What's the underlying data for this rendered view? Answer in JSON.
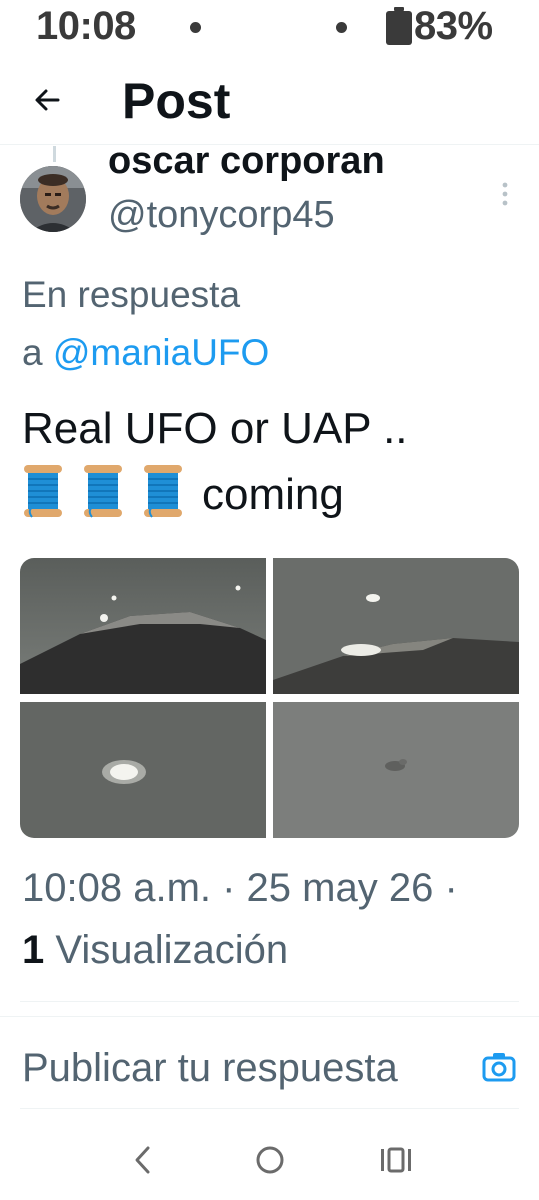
{
  "status_bar": {
    "time": "10:08",
    "battery": "83%"
  },
  "header": {
    "title": "Post"
  },
  "author": {
    "name": "oscar corporan",
    "handle": "@tonycorp45"
  },
  "reply_context": {
    "prefix": "En respuesta",
    "to": "a",
    "mention": "@maniaUFO"
  },
  "tweet": {
    "text_line1": "Real UFO or UAP ..",
    "spool_emoji": "🧵",
    "text_line2_suffix": "coming"
  },
  "meta": {
    "timestamp": "10:08 a.m. · 25 may 26 ·",
    "views_count": "1",
    "views_label": "Visualización"
  },
  "reply_box": {
    "placeholder": "Publicar tu respuesta"
  },
  "colors": {
    "accent": "#1d9bf0",
    "text": "#0f1419",
    "secondary": "#536471"
  },
  "icons": [
    "back-arrow-icon",
    "more-vertical-icon",
    "spool-of-thread-icon",
    "camera-icon",
    "nav-back-icon",
    "nav-home-icon",
    "nav-recents-icon"
  ]
}
